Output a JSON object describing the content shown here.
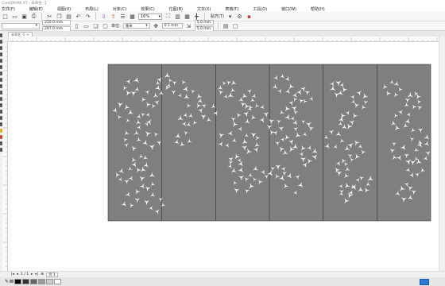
{
  "window": {
    "title": "CorelDRAW X7 - 未命名 -1"
  },
  "menu": [
    "文件(F)",
    "编辑(E)",
    "视图(V)",
    "布局(L)",
    "对象(C)",
    "效果(C)",
    "位图(B)",
    "文本(X)",
    "表格(T)",
    "工具(O)",
    "窗口(W)",
    "帮助(H)"
  ],
  "toolbar": {
    "zoom": "16%",
    "snap_label": "贴齐(T)"
  },
  "property_bar": {
    "preset": "",
    "width": "210.0 mm",
    "height": "297.0 mm",
    "unit_label": "单位:",
    "unit_value": "毫米",
    "nudge": "0.1 mm",
    "dup_x": "5.0 mm",
    "dup_y": "5.0 mm"
  },
  "document_tab": {
    "label": "未命名 -1"
  },
  "page_nav": {
    "counter": "1 / 1",
    "page_label": "页 1"
  },
  "colors": {
    "panel_fill": "#7f7f7f",
    "pattern": "#ffffff",
    "status_indicator": "#2a7ad8"
  },
  "icons": [
    "new-icon",
    "open-icon",
    "save-icon",
    "print-icon",
    "cut-icon",
    "copy-icon",
    "paste-icon",
    "undo-icon",
    "redo-icon",
    "import-icon",
    "export-icon",
    "zoom-icon",
    "snap-icon",
    "options-icon"
  ]
}
